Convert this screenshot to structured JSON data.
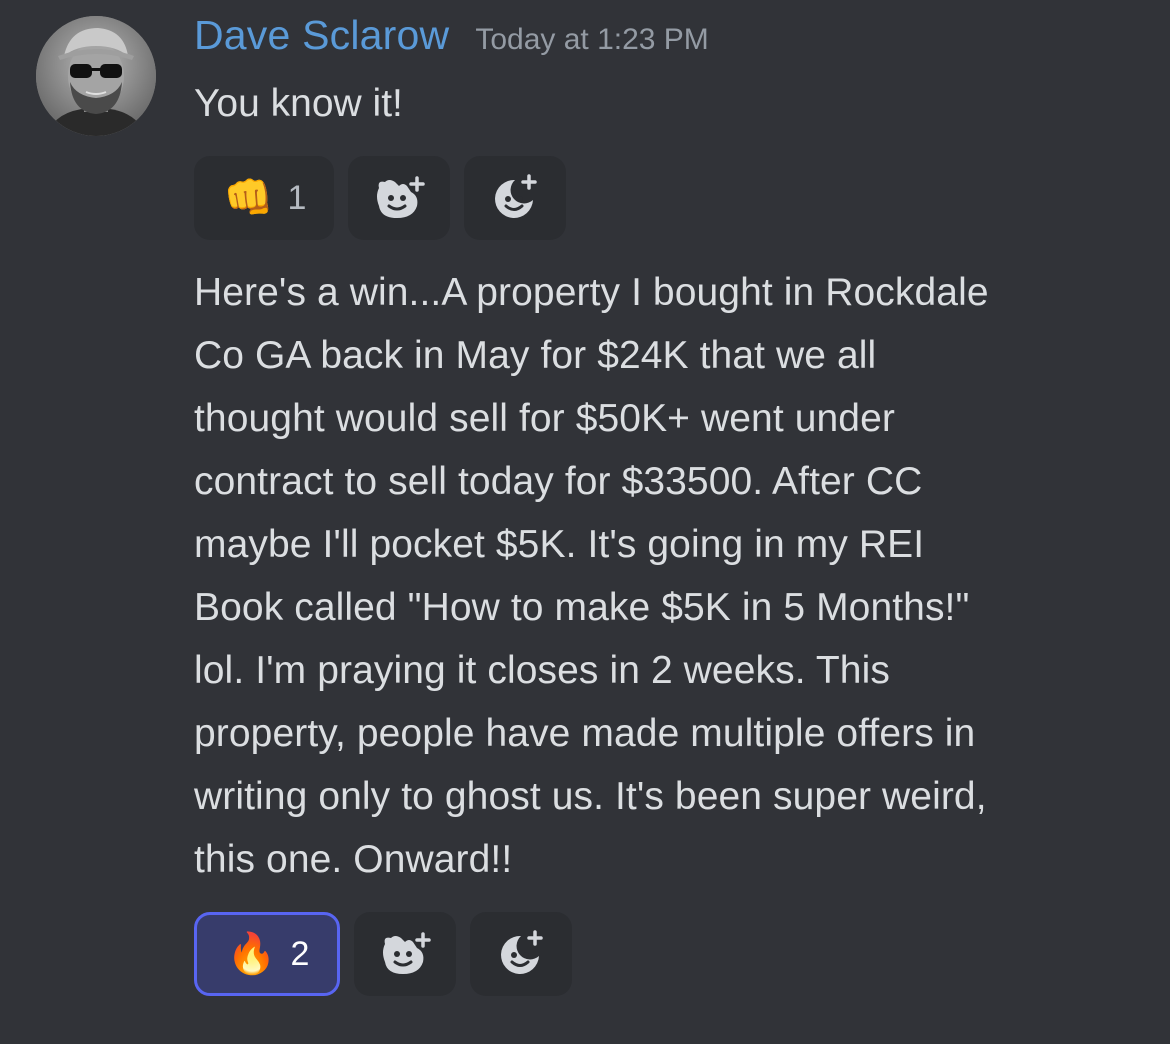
{
  "author": {
    "name": "Dave Sclarow",
    "timestamp": "Today at 1:23 PM",
    "name_color": "#5a9ad8"
  },
  "messages": [
    {
      "text": "You know it!",
      "reactions": {
        "primary": {
          "emoji": "👊",
          "emoji_name": "fist-bump",
          "count": "1",
          "active": false
        },
        "buttons": [
          {
            "icon": "add-super-reaction-icon"
          },
          {
            "icon": "add-reaction-icon"
          }
        ]
      }
    },
    {
      "text": "Here's a win...A property I bought in Rockdale\nCo GA back in May for $24K that we all\nthought would sell for $50K+ went under\ncontract to sell today for $33500. After CC\nmaybe I'll pocket $5K. It's going in my REI\nBook called \"How to make $5K in 5 Months!\"\nlol. I'm praying it closes in 2 weeks. This\nproperty, people have made multiple offers in\nwriting only to ghost us. It's been super weird,\nthis one. Onward!!",
      "reactions": {
        "primary": {
          "emoji": "🔥",
          "emoji_name": "fire",
          "count": "2",
          "active": true
        },
        "buttons": [
          {
            "icon": "add-super-reaction-icon"
          },
          {
            "icon": "add-reaction-icon"
          }
        ]
      }
    }
  ],
  "colors": {
    "background": "#313338",
    "reaction_bg": "#2b2d31",
    "reaction_active_bg": "#373c6b",
    "reaction_active_border": "#5865f2"
  }
}
